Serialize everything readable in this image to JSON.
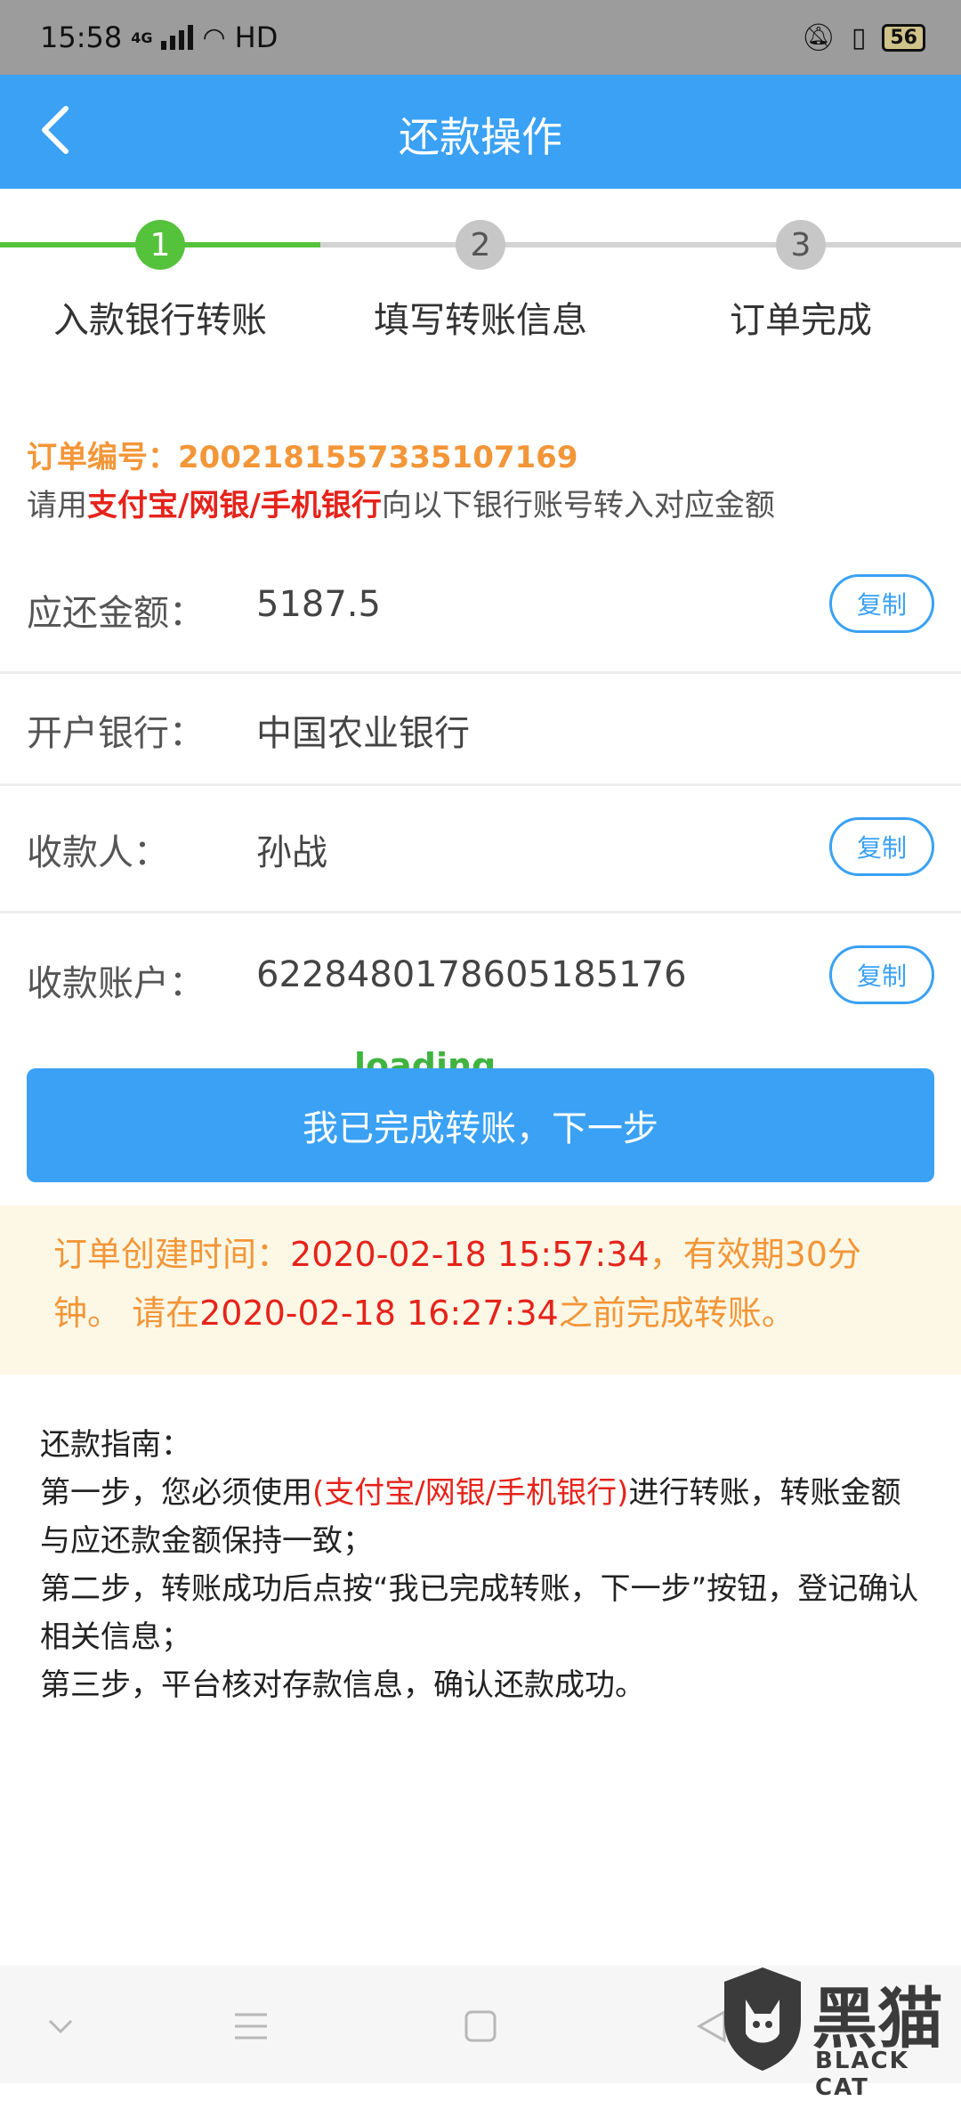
{
  "status_bar": {
    "time": "15:58",
    "network": "4G",
    "wifi_label": "HD",
    "battery": "56"
  },
  "header": {
    "title": "还款操作"
  },
  "stepper": {
    "steps": [
      {
        "number": "1",
        "label": "入款银行转账"
      },
      {
        "number": "2",
        "label": "填写转账信息"
      },
      {
        "number": "3",
        "label": "订单完成"
      }
    ]
  },
  "order": {
    "label": "订单编号：",
    "number": "2002181557335107169",
    "hint_pre": "请用",
    "hint_methods": "支付宝/网银/手机银行",
    "hint_post": "向以下银行账号转入对应金额"
  },
  "rows": [
    {
      "label": "应还金额：",
      "value": "5187.5",
      "copy": "复制"
    },
    {
      "label": "开户银行：",
      "value": "中国农业银行"
    },
    {
      "label": "收款人：",
      "value": "孙战",
      "copy": "复制"
    },
    {
      "label": "收款账户：",
      "value": "6228480178605185176",
      "copy": "复制"
    }
  ],
  "loading_text": "loading",
  "primary_button": "我已完成转账，下一步",
  "notice": {
    "p1": "订单创建时间：",
    "created": "2020-02-18 15:57:34",
    "p2": "，有效期30分钟。 请在",
    "deadline": "2020-02-18 16:27:34",
    "p3": "之前完成转账。"
  },
  "guide": {
    "title": "还款指南：",
    "s1_pre": "第一步，您必须使用",
    "s1_methods": "(支付宝/网银/手机银行)",
    "s1_post": "进行转账，转账金额与应还款金额保持一致；",
    "s2": "第二步，转账成功后点按“我已完成转账，下一步”按钮，登记确认相关信息；",
    "s3": "第三步，平台核对存款信息，确认还款成功。"
  },
  "watermark": {
    "name": "黑猫",
    "sub": "BLACK CAT"
  },
  "colors": {
    "primary": "#3aa1f4",
    "step_active": "#55c23c",
    "order_orange": "#f39638",
    "highlight_red": "#e5231b",
    "notice_bg": "#fdf8e6"
  }
}
